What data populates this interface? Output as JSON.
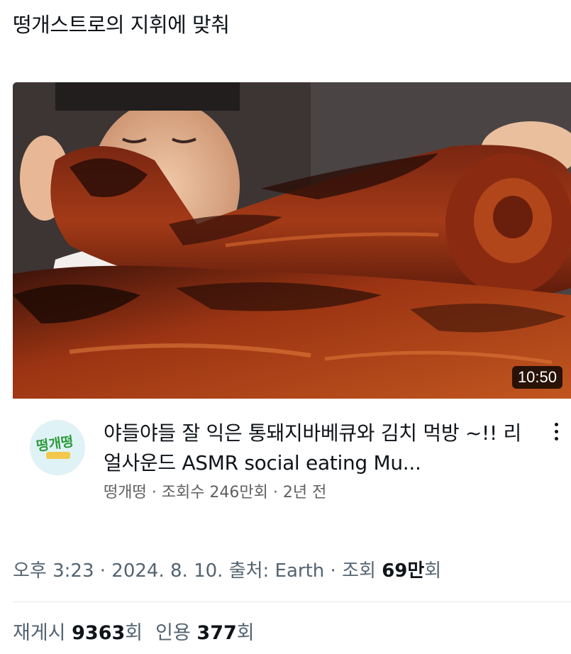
{
  "post": {
    "text": "떵개스트로의 지휘에 맞춰"
  },
  "video": {
    "duration": "10:50",
    "title": "야들야들 잘 익은 통돼지바베큐와 김치 먹방 ~!! 리얼사운드 ASMR social eating Mu...",
    "channel": "떵개떵",
    "views": "조회수 246만회",
    "age": "2년 전",
    "separator": " · ",
    "avatar_text": "떵개떵",
    "thumbnail_icon": "bbq-pork-thumbnail"
  },
  "meta": {
    "time": "오후 3:23",
    "date": "2024. 8. 10.",
    "source_label": "출처: Earth",
    "views_label": "조회",
    "views_count": "69만",
    "views_suffix": "회",
    "sep": " · "
  },
  "stats": {
    "repost_label": "재게시",
    "repost_count": "9363",
    "repost_suffix": "회",
    "quote_label": "인용",
    "quote_count": "377",
    "quote_suffix": "회"
  },
  "colors": {
    "text": "#0f1419",
    "muted": "#536471",
    "video_meta": "#606060",
    "divider": "#e1e8ed"
  }
}
